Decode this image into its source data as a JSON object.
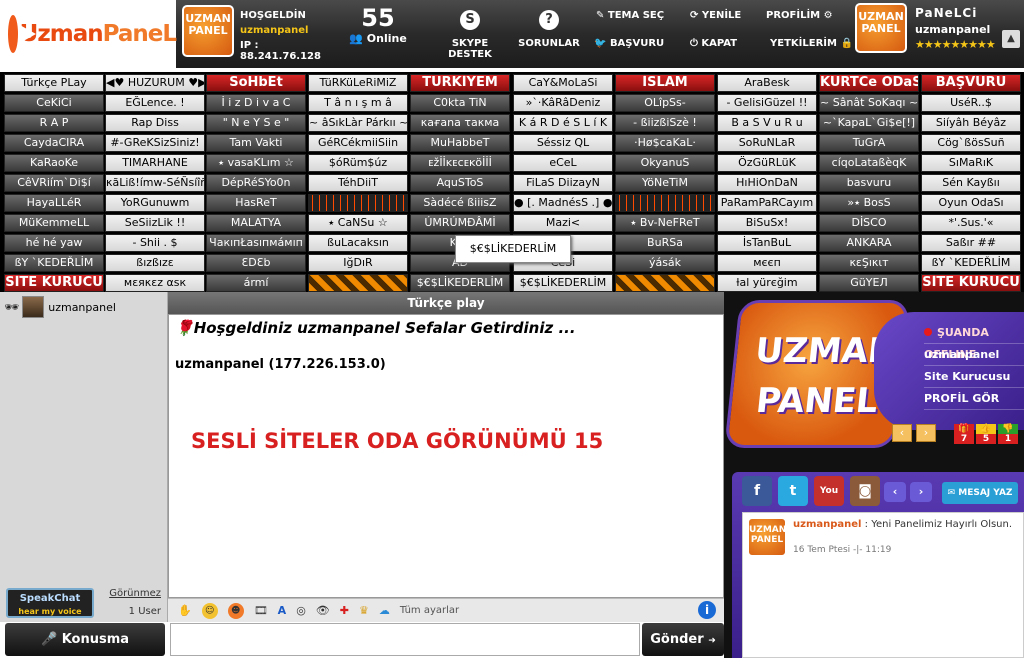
{
  "logo": {
    "text_a": "Uzman",
    "text_b": "PaneL"
  },
  "header": {
    "greeting": "HOŞGELDİN",
    "username": "uzmanpanel",
    "ip": "IP : 88.241.76.128",
    "online_count": "55",
    "online_label": "Online",
    "skype": "SKYPE DESTEK",
    "sorunlar": "SORUNLAR",
    "tema": "TEMA SEÇ",
    "basvuru": "BAŞVURU",
    "yenile": "YENİLE",
    "kapat": "KAPAT",
    "profilim": "PROFİLİM",
    "yetkilerim": "YETKİLERİM",
    "panel_name": "PaNeLCi",
    "panel_user": "uzmanpanel",
    "stars": "★★★★★★★★★",
    "badge_top": "UZMAN",
    "badge_bottom": "PANEL"
  },
  "rooms": [
    [
      "Türkçe PLay",
      "◀♥ HUZURUM ♥▶",
      "SoHbEt",
      "TüRKüLeRiMiZ",
      "TÜRKİYEM",
      "CaY&MoLaSi",
      "İSLAM",
      "AraBesk",
      "KÜRTCe ODaSi",
      "BAŞVURU"
    ],
    [
      "CeKiCi",
      "EĞLence. !",
      "İ i z D i v a C",
      "T â n ı ş m â",
      "C0kta TiN",
      "»`·KâRâDeniz",
      "OLîpSs-",
      "- GelisiGüzel !!",
      "~ Sânât SoKaqı ~",
      "UséR..$"
    ],
    [
      "R A P",
      "Rap Diss",
      "\" N e Y S e \"",
      "~ âSıkLàr Párkıı ~",
      "κaғana τaκмa",
      "K á R D é S L í K",
      "- ßiizßiSzè !",
      "B a S V u R u",
      "~`KapaL`Gi$e[!]",
      "Siíyâh Béyâz"
    ],
    [
      "CaydaCIRA",
      "#-GReKSizSiniz!",
      "Tam Vakti",
      "GéRCékmiiSiin",
      "MuHabbeT",
      "Séssiz QL",
      "·Hø$caKaL·",
      "SoRuNLaR",
      "TuGrA",
      "Cög`ßösSuñ"
    ],
    [
      "KaRaoKe",
      "TIMARHANE",
      "٭ vasaKLım ☆",
      "$óRüm$úz",
      "ᴇžİİᴋᴇᴄᴇᴋöİİİ",
      "eCeL",
      "OkyanuS",
      "ÖzGüRLüK",
      "cíqoLataßèqK",
      "SıMaRıK"
    ],
    [
      "CêVRiím`Di$í",
      "κãLiß!ímw-SéÑsíîñ",
      "DépRéSYo0n",
      "TéhDiiT",
      "AquSToS",
      "FiLaS DiizayN",
      "YöNeTiM",
      "HıHiOnDaN",
      "basvuru",
      "Sén Kayßıı"
    ],
    [
      "HayaLLéR",
      "YoRGunuwm",
      "HasReT",
      "",
      "Sàdécé ßiiisZ",
      "● [. MadnésS .] ●",
      "",
      "PaRamPaRCayım",
      "»٭ BosS",
      "Oyun OdaSı"
    ],
    [
      "MüKemmeLL",
      "SeSiizLik !!",
      "MALATYA",
      "٭ CaNSu ☆",
      "ÚMRÚMĐÂMİ",
      "Mazi<",
      "٭ Bv-NeFReT",
      "BiSuSx!",
      "DİSCO",
      "*'.Sus.'«"
    ],
    [
      "hé hé yaw",
      "- Shii . $",
      "ЧaкıпŁasıпмáмıп",
      "ßuLacaksın",
      "Kah",
      "R",
      "BuRSa",
      "İsTanBuL",
      "ANKARA",
      "Saßır ##"
    ],
    [
      "ßY `KEDEŘLİM",
      "ßızßızε",
      "ƐDƐb",
      "IğDıR",
      "AD",
      "CeSi",
      "ýásák",
      "мєєп",
      "κεŞıκιт",
      "ßY `KEDEŘLİM"
    ],
    [
      "SİTE KURUCU",
      "мεяκεz αѕк",
      "ármí",
      "",
      "$€$LİKEDERLİM",
      "$€$LİKEDERLİM",
      "",
      "ƚal yürєğim",
      "GüYEЛ",
      "SİTE KURUCU"
    ]
  ],
  "tooltip": "$€$LİKEDERLİM",
  "userlist": {
    "me": "uzmanpanel",
    "status": "Görünmez",
    "count": "1 User",
    "speak_a": "SpeakChat",
    "speak_b": "hear my voice"
  },
  "chat": {
    "header": "Türkçe play",
    "welcome": "Hoşgeldiniz uzmanpanel Sefalar Getirdiniz ...",
    "entry": "uzmanpanel (177.226.153.0)",
    "banner": "SESLİ SİTELER ODA GÖRÜNÜMÜ 15",
    "settings": "Tüm ayarlar",
    "send": "Gönder",
    "talk": "Konusma"
  },
  "promo": {
    "logo1": "UZMAN",
    "logo2": "PANEL",
    "offline": "ŞUANDA OFFLINE",
    "user": "uzmanpanel",
    "role": "Site Kurucusu",
    "profile": "PROFİL GÖR",
    "v1": "7",
    "v2": "5",
    "v3": "1"
  },
  "social": {
    "mesaj": "MESAJ YAZ",
    "feed_user": "uzmanpanel",
    "feed_msg": " : Yeni Panelimiz Hayırlı Olsun.",
    "feed_date": "16 Tem Ptesi -|- 11:19"
  },
  "colors": {
    "accent": "#f05a1a",
    "banner": "#d82020",
    "purple": "#5a3ab2"
  }
}
